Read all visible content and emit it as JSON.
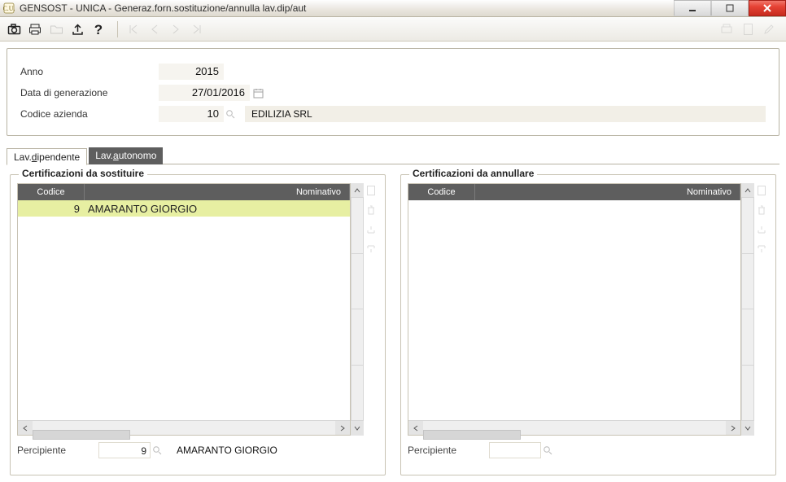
{
  "window": {
    "title": "GENSOST  - UNICA -  Generaz.forn.sostituzione/annulla lav.dip/aut",
    "app_icon_label": "C.U."
  },
  "toolbar": {
    "nav": {
      "first": "|◀",
      "prev": "◀",
      "next": "▶",
      "last": "▶|"
    }
  },
  "form": {
    "anno": {
      "label": "Anno",
      "value": "2015"
    },
    "data_generazione": {
      "label": "Data di generazione",
      "value": "27/01/2016"
    },
    "codice_azienda": {
      "label": "Codice azienda",
      "value": "10",
      "name": "EDILIZIA SRL"
    }
  },
  "tabs": {
    "dip_prefix": "Lav.",
    "dip_ul": "d",
    "dip_suffix": "ipendente",
    "aut_prefix": "Lav.",
    "aut_ul": "a",
    "aut_suffix": "utonomo",
    "active": "dipendente"
  },
  "groups": {
    "left": {
      "title": "Certificazioni da sostituire",
      "cols": {
        "codice": "Codice",
        "nominativo": "Nominativo"
      },
      "rows": [
        {
          "codice": "9",
          "nominativo": "AMARANTO GIORGIO"
        }
      ],
      "percipiente_label": "Percipiente",
      "percipiente_code": "9",
      "percipiente_name": "AMARANTO GIORGIO"
    },
    "right": {
      "title": "Certificazioni da annullare",
      "cols": {
        "codice": "Codice",
        "nominativo": "Nominativo"
      },
      "rows": [],
      "percipiente_label": "Percipiente",
      "percipiente_code": "",
      "percipiente_name": ""
    }
  }
}
